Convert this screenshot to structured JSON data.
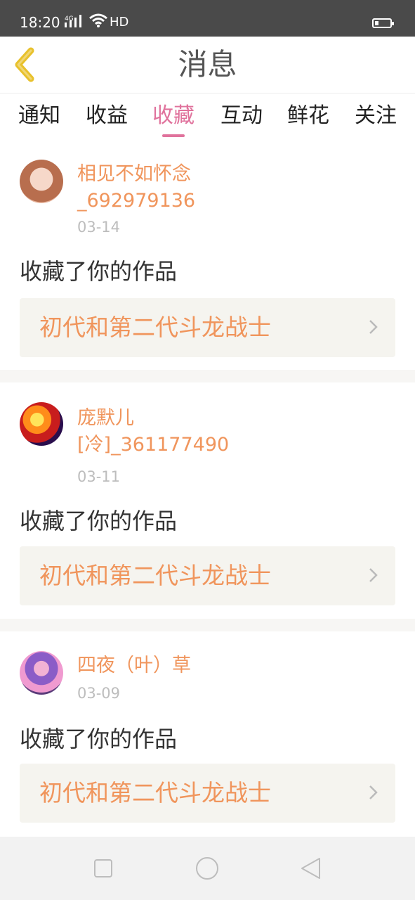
{
  "status_bar": {
    "time": "18:20",
    "signal_label": "4G",
    "hd_label": "HD",
    "icons": [
      "signal-icon",
      "wifi-icon",
      "battery-icon"
    ]
  },
  "header": {
    "title": "消息",
    "back_icon": "chevron-left-icon"
  },
  "tabs": [
    {
      "label": "通知",
      "active": false
    },
    {
      "label": "收益",
      "active": false
    },
    {
      "label": "收藏",
      "active": true
    },
    {
      "label": "互动",
      "active": false
    },
    {
      "label": "鲜花",
      "active": false
    },
    {
      "label": "关注",
      "active": false
    }
  ],
  "messages": [
    {
      "username_line1": "相见不如怀念",
      "username_line2": "_692979136",
      "date": "03-14",
      "action": "收藏了你的作品",
      "work_title": "初代和第二代斗龙战士"
    },
    {
      "username_line1": "庞默儿",
      "username_line2": "[冷]_361177490",
      "date": "03-11",
      "action": "收藏了你的作品",
      "work_title": "初代和第二代斗龙战士"
    },
    {
      "username_line1": "四夜（叶）草",
      "username_line2": "",
      "date": "03-09",
      "action": "收藏了你的作品",
      "work_title": "初代和第二代斗龙战士"
    }
  ],
  "colors": {
    "accent_pink": "#e0729c",
    "username_orange": "#f0955c",
    "status_bar_bg": "#4a4a4a",
    "card_bg": "#f5f4ef",
    "back_arrow": "#e8c12c"
  },
  "nav_bar": {
    "buttons": [
      "recent-apps-icon",
      "home-icon",
      "back-triangle-icon"
    ]
  }
}
